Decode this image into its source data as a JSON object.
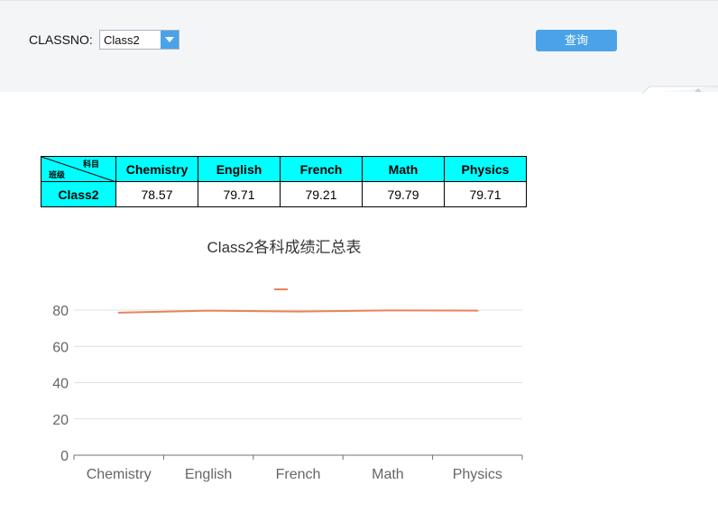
{
  "filter": {
    "label": "CLASSNO:",
    "selected": "Class2",
    "query_label": "查询"
  },
  "table": {
    "corner_top": "科目",
    "corner_bottom": "班级",
    "headers": [
      "Chemistry",
      "English",
      "French",
      "Math",
      "Physics"
    ],
    "row_label": "Class2",
    "values": [
      "78.57",
      "79.71",
      "79.21",
      "79.79",
      "79.71"
    ]
  },
  "chart_data": {
    "type": "line",
    "title": "Class2各科成绩汇总表",
    "categories": [
      "Chemistry",
      "English",
      "French",
      "Math",
      "Physics"
    ],
    "series": [
      {
        "values": [
          78.57,
          79.71,
          79.21,
          79.79,
          79.71
        ],
        "color": "#e8835a"
      }
    ],
    "ylim": [
      0,
      80
    ],
    "yticks": [
      0,
      20,
      40,
      60,
      80
    ],
    "grid": true,
    "legend": "top-center"
  }
}
